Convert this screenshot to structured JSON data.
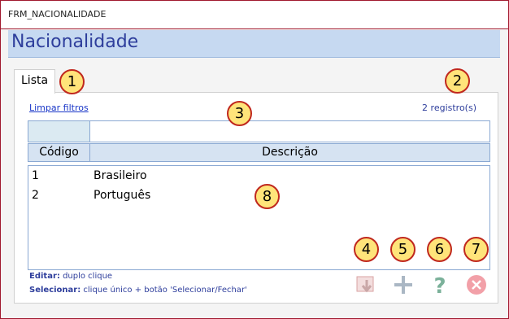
{
  "window": {
    "title": "FRM_NACIONALIDADE"
  },
  "header": {
    "title": "Nacionalidade"
  },
  "tab": {
    "label": "Lista"
  },
  "toolbar": {
    "clear_filters": "Limpar filtros",
    "record_count": "2 registro(s)"
  },
  "table": {
    "columns": [
      "Código",
      "Descrição"
    ],
    "rows": [
      {
        "code": "1",
        "description": "Brasileiro"
      },
      {
        "code": "2",
        "description": "Português"
      }
    ]
  },
  "hints": {
    "edit_label": "Editar:",
    "edit_text": "duplo clique",
    "select_label": "Selecionar:",
    "select_text": "clique único + botão 'Selecionar/Fechar'"
  },
  "annotations": [
    "1",
    "2",
    "3",
    "4",
    "5",
    "6",
    "7",
    "8"
  ],
  "icons": {
    "select": "select-close-icon",
    "add": "add-icon",
    "help": "help-icon",
    "close": "close-icon"
  }
}
